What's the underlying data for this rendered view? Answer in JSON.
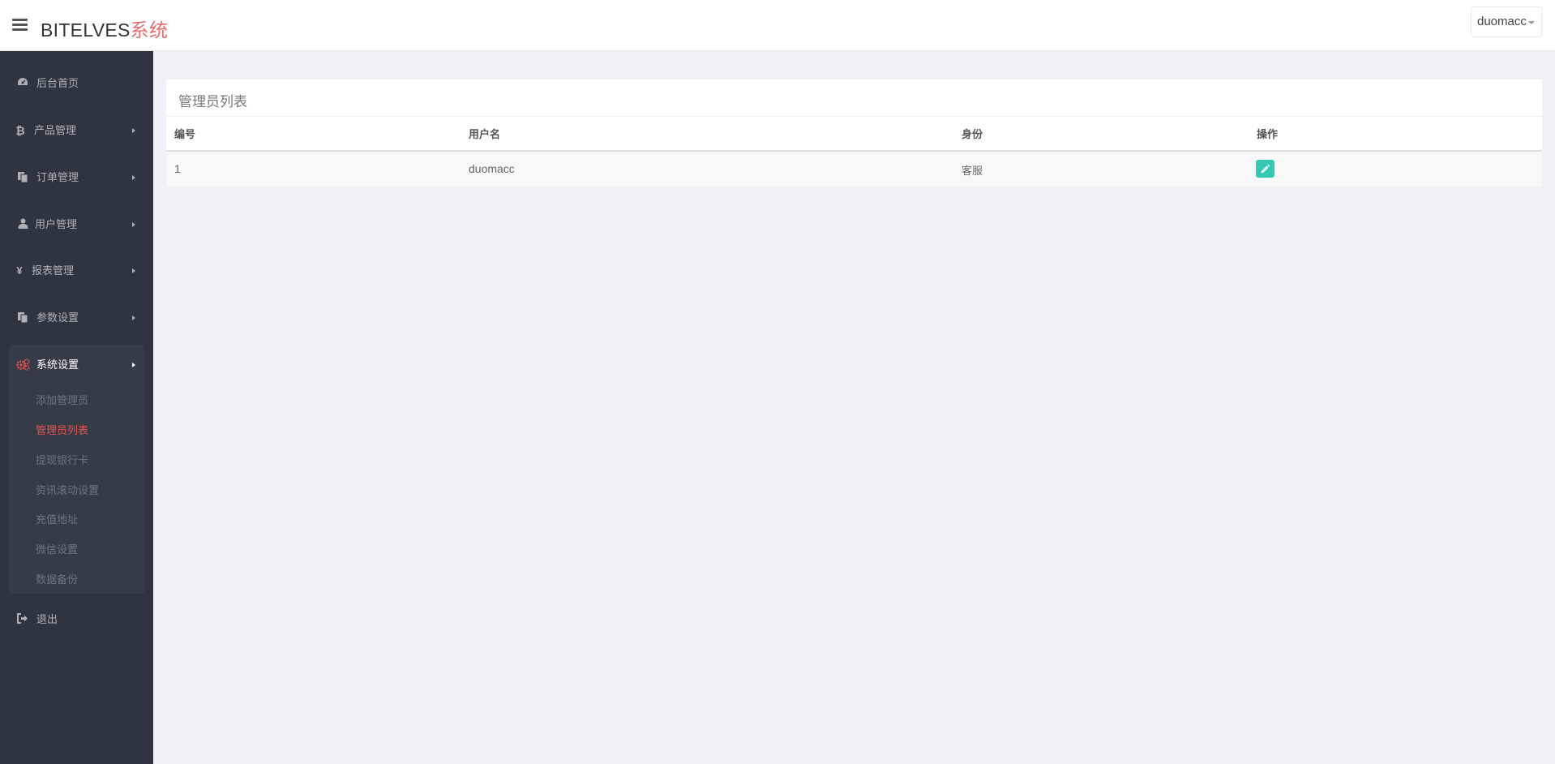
{
  "header": {
    "brand_main": "BITELVES",
    "brand_accent": "系统",
    "user": "duomacc"
  },
  "sidebar": {
    "items": [
      {
        "label": "后台首页",
        "icon": "dashboard-icon"
      },
      {
        "label": "产品管理",
        "icon": "bitcoin-icon"
      },
      {
        "label": "订单管理",
        "icon": "copy-icon"
      },
      {
        "label": "用户管理",
        "icon": "user-icon"
      },
      {
        "label": "报表管理",
        "icon": "yen-icon"
      },
      {
        "label": "参数设置",
        "icon": "copy-icon"
      },
      {
        "label": "系统设置",
        "icon": "cogs-icon"
      },
      {
        "label": "退出",
        "icon": "sign-out-icon"
      }
    ],
    "system_sub": [
      "添加管理员",
      "管理员列表",
      "提现银行卡",
      "资讯滚动设置",
      "充值地址",
      "微信设置",
      "数据备份"
    ]
  },
  "panel": {
    "title": "管理员列表",
    "columns": [
      "编号",
      "用户名",
      "身份",
      "操作"
    ],
    "rows": [
      {
        "id": "1",
        "username": "duomacc",
        "role": "客服"
      }
    ]
  },
  "colors": {
    "accent_red": "#e8534f",
    "sidebar_bg": "#2e3541",
    "edit_button": "#33c8b1"
  }
}
